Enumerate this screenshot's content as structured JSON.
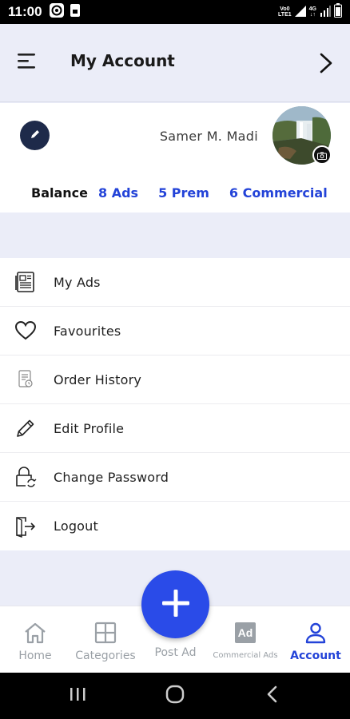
{
  "status_bar": {
    "time": "11:00",
    "network_label_top": "Vo0",
    "network_label_bottom": "LTE1",
    "data_label_top": "4G",
    "data_label_bottom": "↓↑"
  },
  "header": {
    "title": "My Account",
    "menu_icon": "hamburger-icon",
    "forward_icon": "chevron-right-icon"
  },
  "profile": {
    "name": "Samer M. Madi",
    "balance_label": "Balance",
    "ads": "8 Ads",
    "prem": "5 Prem",
    "commercial": "6 Commercial"
  },
  "menu": {
    "items": [
      {
        "label": "My Ads",
        "icon": "newspaper-icon"
      },
      {
        "label": "Favourites",
        "icon": "heart-icon"
      },
      {
        "label": "Order History",
        "icon": "receipt-icon"
      },
      {
        "label": "Edit Profile",
        "icon": "pencil-icon"
      },
      {
        "label": "Change Password",
        "icon": "lock-refresh-icon"
      },
      {
        "label": "Logout",
        "icon": "logout-icon"
      }
    ]
  },
  "bottom_nav": {
    "home": "Home",
    "categories": "Categories",
    "post_ad": "Post Ad",
    "commercial_ads": "Commercial Ads",
    "commercial_ads_badge": "Ad",
    "account": "Account"
  },
  "colors": {
    "accent": "#2343d8",
    "fab": "#2a4be8",
    "header_bg": "#ebedf8",
    "edit_circle": "#1e2a4a"
  }
}
